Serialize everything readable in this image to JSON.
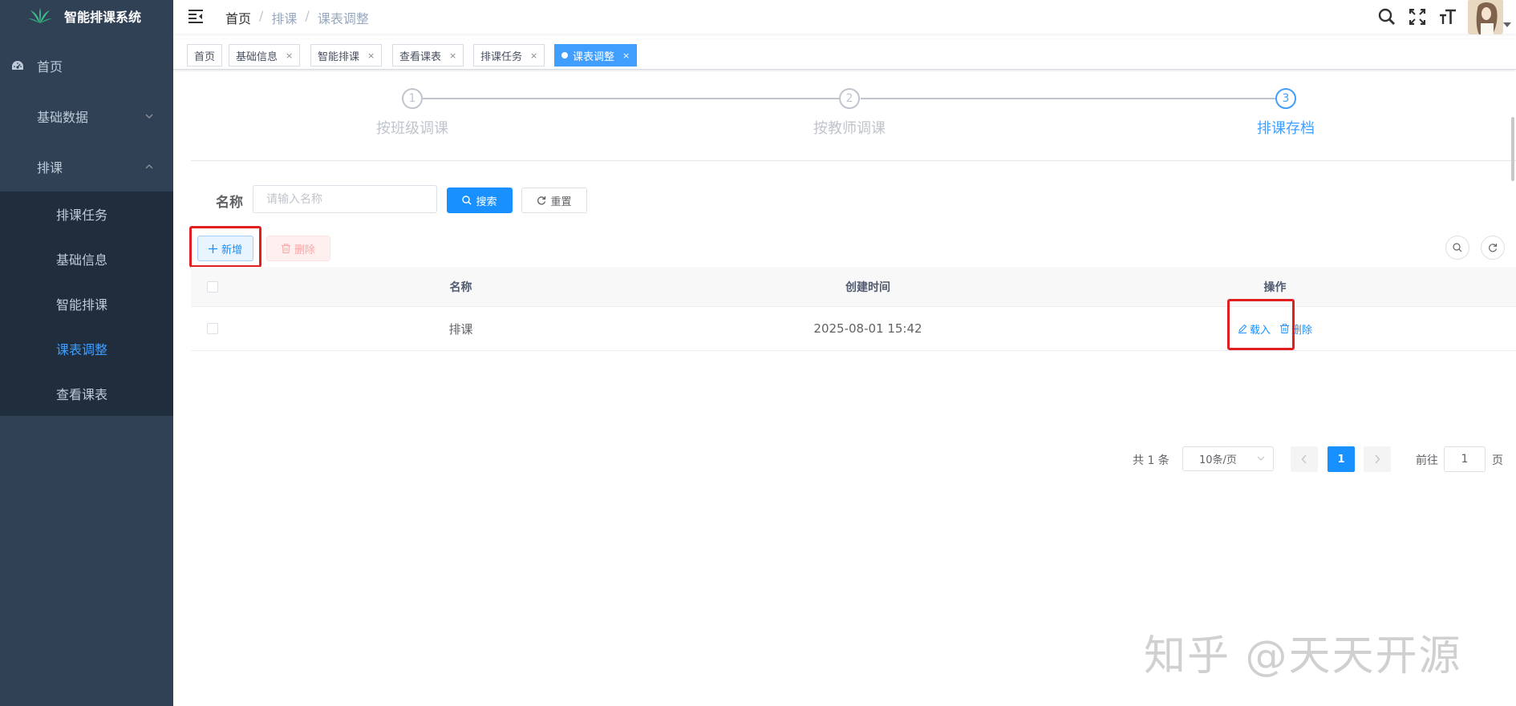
{
  "app": {
    "title": "智能排课系统"
  },
  "sidebar": {
    "items": [
      {
        "label": "首页",
        "icon": "dashboard-icon"
      },
      {
        "label": "基础数据",
        "expanded": false
      },
      {
        "label": "排课",
        "expanded": true
      }
    ],
    "subitems": [
      {
        "label": "排课任务"
      },
      {
        "label": "基础信息"
      },
      {
        "label": "智能排课"
      },
      {
        "label": "课表调整",
        "active": true
      },
      {
        "label": "查看课表"
      }
    ]
  },
  "header": {
    "breadcrumb": {
      "home": "首页",
      "sep": "/",
      "level1": "排课",
      "level2": "课表调整"
    }
  },
  "tags": [
    {
      "label": "首页",
      "closable": false
    },
    {
      "label": "基础信息",
      "closable": true
    },
    {
      "label": "智能排课",
      "closable": true
    },
    {
      "label": "查看课表",
      "closable": true
    },
    {
      "label": "排课任务",
      "closable": true
    },
    {
      "label": "课表调整",
      "closable": true,
      "active": true
    }
  ],
  "tag_close": "×",
  "steps": [
    {
      "number": "1",
      "title": "按班级调课",
      "status": "wait"
    },
    {
      "number": "2",
      "title": "按教师调课",
      "status": "wait"
    },
    {
      "number": "3",
      "title": "排课存档",
      "status": "process"
    }
  ],
  "search": {
    "label": "名称",
    "placeholder": "请输入名称",
    "value": "",
    "search_button": "搜索",
    "reset_button": "重置"
  },
  "toolbar": {
    "add_button": "新增",
    "delete_button": "删除"
  },
  "table": {
    "columns": [
      "名称",
      "创建时间",
      "操作"
    ],
    "rows": [
      {
        "name": "排课",
        "created": "2025-08-01 15:42",
        "actions": [
          "载入",
          "删除"
        ]
      }
    ]
  },
  "pagination": {
    "total": "共 1 条",
    "page_size": "10条/页",
    "current": "1",
    "goto_label": "前往",
    "goto_value": "1",
    "page_suffix": "页"
  },
  "watermark": "知乎 @天天开源",
  "colors": {
    "sidebar_bg": "#304156",
    "submenu_bg": "#1f2d3d",
    "primary": "#1890ff",
    "active_menu": "#409eff",
    "highlight_box": "#e02020"
  }
}
